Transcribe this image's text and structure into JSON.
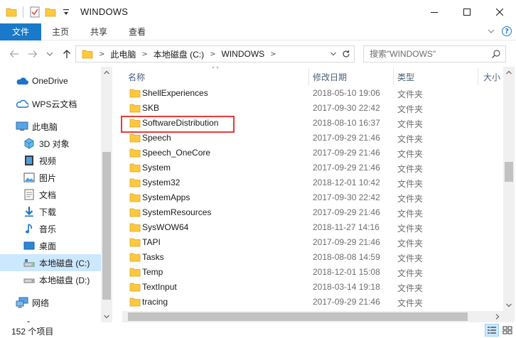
{
  "window": {
    "title": "WINDOWS"
  },
  "ribbon": {
    "tabs": [
      "文件",
      "主页",
      "共享",
      "查看"
    ]
  },
  "address": {
    "crumbs": [
      "此电脑",
      "本地磁盘 (C:)",
      "WINDOWS"
    ]
  },
  "search": {
    "placeholder": "搜索\"WINDOWS\""
  },
  "nav": {
    "items": [
      {
        "label": "OneDrive",
        "icon": "cloud-icon"
      },
      {
        "label": "WPS云文档",
        "icon": "wps-cloud-icon"
      },
      {
        "label": "此电脑",
        "icon": "computer-icon"
      },
      {
        "label": "3D 对象",
        "icon": "3d-objects-icon"
      },
      {
        "label": "视频",
        "icon": "video-icon"
      },
      {
        "label": "图片",
        "icon": "pictures-icon"
      },
      {
        "label": "文档",
        "icon": "documents-icon"
      },
      {
        "label": "下载",
        "icon": "download-icon"
      },
      {
        "label": "音乐",
        "icon": "music-icon"
      },
      {
        "label": "桌面",
        "icon": "desktop-icon"
      },
      {
        "label": "本地磁盘 (C:)",
        "icon": "drive-c-icon",
        "selected": true
      },
      {
        "label": "本地磁盘 (D:)",
        "icon": "drive-d-icon"
      },
      {
        "label": "网络",
        "icon": "network-icon"
      }
    ]
  },
  "columns": {
    "name": "名称",
    "date": "修改日期",
    "type": "类型",
    "size": "大小"
  },
  "files": [
    {
      "name": "ShellExperiences",
      "date": "2018-05-10 19:06",
      "type": "文件夹"
    },
    {
      "name": "SKB",
      "date": "2017-09-30 22:42",
      "type": "文件夹"
    },
    {
      "name": "SoftwareDistribution",
      "date": "2018-08-10 16:37",
      "type": "文件夹",
      "highlighted": true
    },
    {
      "name": "Speech",
      "date": "2017-09-29 21:46",
      "type": "文件夹"
    },
    {
      "name": "Speech_OneCore",
      "date": "2017-09-29 21:46",
      "type": "文件夹"
    },
    {
      "name": "System",
      "date": "2017-09-29 21:46",
      "type": "文件夹"
    },
    {
      "name": "System32",
      "date": "2018-12-01 10:42",
      "type": "文件夹"
    },
    {
      "name": "SystemApps",
      "date": "2017-09-30 22:42",
      "type": "文件夹"
    },
    {
      "name": "SystemResources",
      "date": "2017-09-29 21:46",
      "type": "文件夹"
    },
    {
      "name": "SysWOW64",
      "date": "2018-11-27 14:16",
      "type": "文件夹"
    },
    {
      "name": "TAPI",
      "date": "2017-09-29 21:46",
      "type": "文件夹"
    },
    {
      "name": "Tasks",
      "date": "2018-08-08 14:59",
      "type": "文件夹"
    },
    {
      "name": "Temp",
      "date": "2018-12-01 15:08",
      "type": "文件夹"
    },
    {
      "name": "TextInput",
      "date": "2018-03-14 19:18",
      "type": "文件夹"
    },
    {
      "name": "tracing",
      "date": "2017-09-29 21:46",
      "type": "文件夹"
    }
  ],
  "status": {
    "count": "152 个项目"
  },
  "colors": {
    "accent": "#1979ca",
    "folder": "#ffc83d",
    "selection": "#cce8ff",
    "highlight_box": "#e83a3a"
  }
}
